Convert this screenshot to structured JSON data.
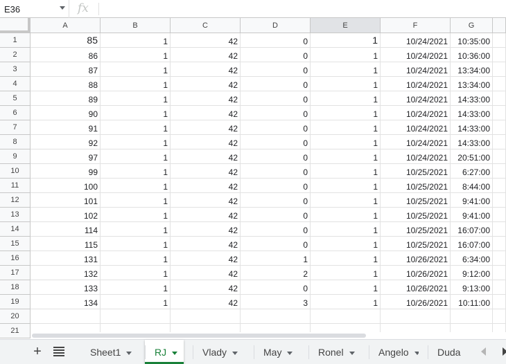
{
  "formula_bar": {
    "cell_ref": "E36",
    "fx_label": "fx",
    "formula_value": ""
  },
  "grid": {
    "columns": [
      "A",
      "B",
      "C",
      "D",
      "E",
      "F",
      "G"
    ],
    "selected_column": "E",
    "rows": [
      {
        "n": "1",
        "cells": [
          "85",
          "1",
          "42",
          "0",
          "1",
          "10/24/2021",
          "10:35:00"
        ]
      },
      {
        "n": "2",
        "cells": [
          "86",
          "1",
          "42",
          "0",
          "1",
          "10/24/2021",
          "10:36:00"
        ]
      },
      {
        "n": "3",
        "cells": [
          "87",
          "1",
          "42",
          "0",
          "1",
          "10/24/2021",
          "13:34:00"
        ]
      },
      {
        "n": "4",
        "cells": [
          "88",
          "1",
          "42",
          "0",
          "1",
          "10/24/2021",
          "13:34:00"
        ]
      },
      {
        "n": "5",
        "cells": [
          "89",
          "1",
          "42",
          "0",
          "1",
          "10/24/2021",
          "14:33:00"
        ]
      },
      {
        "n": "6",
        "cells": [
          "90",
          "1",
          "42",
          "0",
          "1",
          "10/24/2021",
          "14:33:00"
        ]
      },
      {
        "n": "7",
        "cells": [
          "91",
          "1",
          "42",
          "0",
          "1",
          "10/24/2021",
          "14:33:00"
        ]
      },
      {
        "n": "8",
        "cells": [
          "92",
          "1",
          "42",
          "0",
          "1",
          "10/24/2021",
          "14:33:00"
        ]
      },
      {
        "n": "9",
        "cells": [
          "97",
          "1",
          "42",
          "0",
          "1",
          "10/24/2021",
          "20:51:00"
        ]
      },
      {
        "n": "10",
        "cells": [
          "99",
          "1",
          "42",
          "0",
          "1",
          "10/25/2021",
          "6:27:00"
        ]
      },
      {
        "n": "11",
        "cells": [
          "100",
          "1",
          "42",
          "0",
          "1",
          "10/25/2021",
          "8:44:00"
        ]
      },
      {
        "n": "12",
        "cells": [
          "101",
          "1",
          "42",
          "0",
          "1",
          "10/25/2021",
          "9:41:00"
        ]
      },
      {
        "n": "13",
        "cells": [
          "102",
          "1",
          "42",
          "0",
          "1",
          "10/25/2021",
          "9:41:00"
        ]
      },
      {
        "n": "14",
        "cells": [
          "114",
          "1",
          "42",
          "0",
          "1",
          "10/25/2021",
          "16:07:00"
        ]
      },
      {
        "n": "15",
        "cells": [
          "115",
          "1",
          "42",
          "0",
          "1",
          "10/25/2021",
          "16:07:00"
        ]
      },
      {
        "n": "16",
        "cells": [
          "131",
          "1",
          "42",
          "1",
          "1",
          "10/26/2021",
          "6:34:00"
        ]
      },
      {
        "n": "17",
        "cells": [
          "132",
          "1",
          "42",
          "2",
          "1",
          "10/26/2021",
          "9:12:00"
        ]
      },
      {
        "n": "18",
        "cells": [
          "133",
          "1",
          "42",
          "0",
          "1",
          "10/26/2021",
          "9:13:00"
        ]
      },
      {
        "n": "19",
        "cells": [
          "134",
          "1",
          "42",
          "3",
          "1",
          "10/26/2021",
          "10:11:00"
        ]
      },
      {
        "n": "20",
        "cells": [
          "",
          "",
          "",
          "",
          "",
          "",
          ""
        ]
      },
      {
        "n": "21",
        "cells": [
          "",
          "",
          "",
          "",
          "",
          "",
          ""
        ]
      }
    ]
  },
  "sheet_tabs": {
    "add_label": "+",
    "tabs": [
      {
        "label": "Sheet1",
        "active": false
      },
      {
        "label": "RJ",
        "active": true
      },
      {
        "label": "Vlady",
        "active": false
      },
      {
        "label": "May",
        "active": false
      },
      {
        "label": "Ronel",
        "active": false
      },
      {
        "label": "Angelo",
        "active": false
      },
      {
        "label": "Duda",
        "active": false
      }
    ]
  },
  "colors": {
    "active_tab": "#188038",
    "header_bg": "#f8f9fa",
    "selected_header_bg": "#e1e3e6"
  }
}
